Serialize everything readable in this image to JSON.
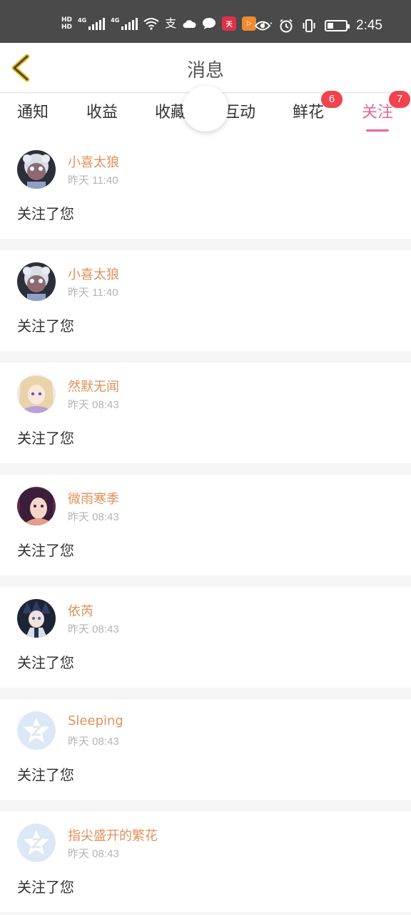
{
  "status_bar": {
    "hd1": "HD",
    "hd2": "HD",
    "net1": "4G",
    "net2": "4G",
    "time": "2:45",
    "battery_level": 0.35,
    "more": "···",
    "icons": [
      "signal-icon",
      "wifi-icon",
      "alipay-icon",
      "cloud-icon",
      "chat-icon",
      "app-icon",
      "video-app-icon",
      "eye-icon",
      "alarm-icon",
      "vibrate-icon",
      "battery-icon"
    ]
  },
  "header": {
    "title": "消息",
    "back_icon": "chevron-left-icon"
  },
  "tabs": [
    {
      "label": "通知",
      "badge": ""
    },
    {
      "label": "收益",
      "badge": ""
    },
    {
      "label": "收藏",
      "badge": ""
    },
    {
      "label": "互动",
      "badge": ""
    },
    {
      "label": "鲜花",
      "badge": "6"
    },
    {
      "label": "关注",
      "badge": "7"
    }
  ],
  "active_tab": "关注",
  "colors": {
    "accent": "#e8659a",
    "badge": "#f1424d",
    "username": "#e0915c"
  },
  "notifications": [
    {
      "name": "小喜太狼",
      "time": "昨天 11:40",
      "message": "关注了您",
      "avatar": "wolf-avatar"
    },
    {
      "name": "小喜太狼",
      "time": "昨天 11:40",
      "message": "关注了您",
      "avatar": "wolf-avatar"
    },
    {
      "name": "然默无闻",
      "time": "昨天 08:43",
      "message": "关注了您",
      "avatar": "anime-girl-avatar"
    },
    {
      "name": "微雨寒季",
      "time": "昨天 08:43",
      "message": "关注了您",
      "avatar": "anime-girl-avatar"
    },
    {
      "name": "依芮",
      "time": "昨天 08:43",
      "message": "关注了您",
      "avatar": "anime-boy-avatar"
    },
    {
      "name": "Sleeping",
      "time": "昨天 08:43",
      "message": "关注了您",
      "avatar": "default-avatar"
    },
    {
      "name": "指尖盛开的繁花",
      "time": "昨天 08:43",
      "message": "关注了您",
      "avatar": "default-avatar"
    }
  ]
}
